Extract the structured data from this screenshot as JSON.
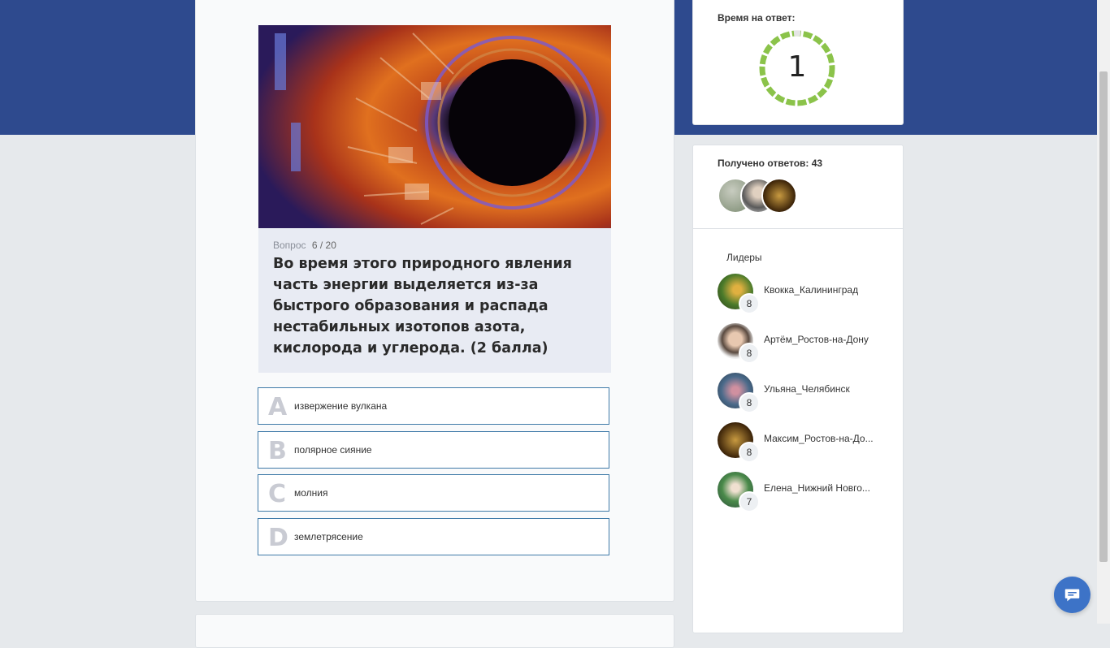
{
  "question": {
    "label": "Вопрос",
    "number": "6 / 20",
    "text": "Во время этого природного явления часть энергии выделяется из-за быстрого образования и распада нестабильных изотопов азота, кислорода и углерода. (2 балла)"
  },
  "answers": [
    {
      "letter": "A",
      "text": "извержение вулкана"
    },
    {
      "letter": "B",
      "text": "полярное сияние"
    },
    {
      "letter": "C",
      "text": "молния"
    },
    {
      "letter": "D",
      "text": "землетрясение"
    }
  ],
  "timer": {
    "label": "Время на ответ:",
    "value": "1"
  },
  "responses": {
    "label": "Получено ответов: 43"
  },
  "leaders": {
    "title": "Лидеры",
    "items": [
      {
        "name": "Квокка_Калининград",
        "score": "8"
      },
      {
        "name": "Артём_Ростов-на-Дону",
        "score": "8"
      },
      {
        "name": "Ульяна_Челябинск",
        "score": "8"
      },
      {
        "name": "Максим_Ростов-на-До...",
        "score": "8"
      },
      {
        "name": "Елена_Нижний Новго...",
        "score": "7"
      }
    ]
  },
  "colors": {
    "header_band": "#2e4a8e",
    "timer_ring": "#8bc34a",
    "answer_border": "#3f7aa8",
    "chat_button": "#3d73c7"
  },
  "icons": {
    "chat": "chat-bubble-icon"
  }
}
